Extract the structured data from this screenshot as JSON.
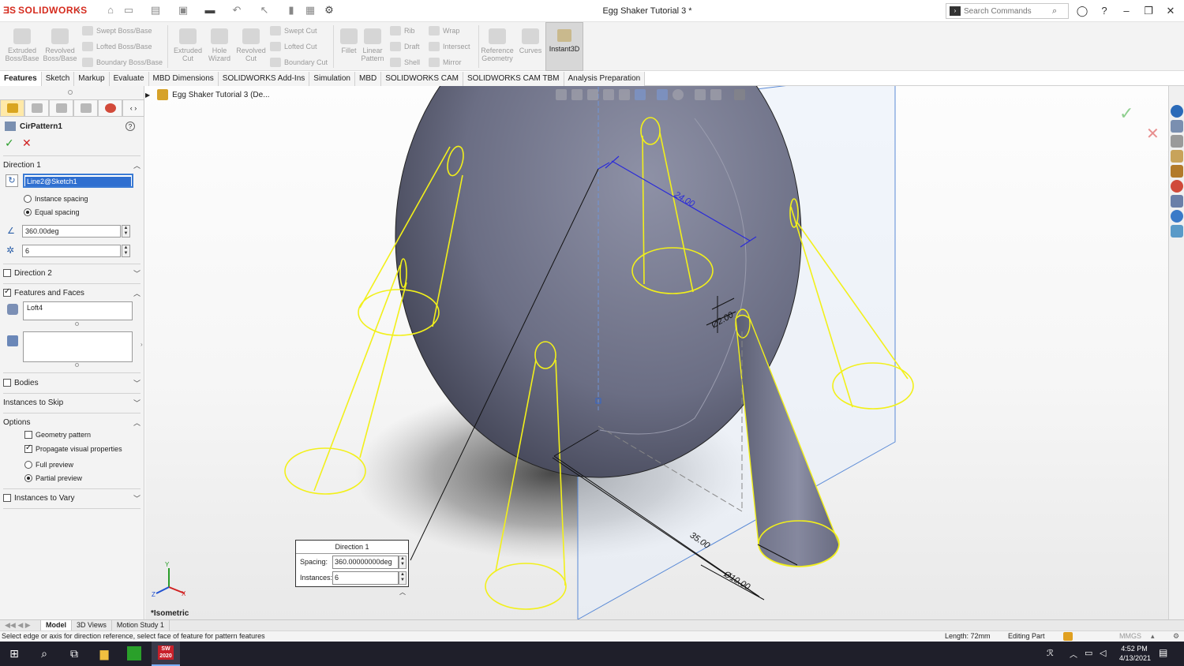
{
  "app": {
    "brand": "SOLIDWORKS",
    "brand_color": "#d52b1e",
    "title": "Egg Shaker Tutorial 3 *",
    "search_placeholder": "Search Commands"
  },
  "ribbon": {
    "extruded_boss": "Extruded Boss/Base",
    "revolved_boss": "Revolved Boss/Base",
    "swept_boss": "Swept Boss/Base",
    "lofted_boss": "Lofted Boss/Base",
    "boundary_boss": "Boundary Boss/Base",
    "extruded_cut": "Extruded Cut",
    "hole_wizard": "Hole Wizard",
    "revolved_cut": "Revolved Cut",
    "swept_cut": "Swept Cut",
    "lofted_cut": "Lofted Cut",
    "boundary_cut": "Boundary Cut",
    "fillet": "Fillet",
    "linear_pattern": "Linear Pattern",
    "rib": "Rib",
    "draft": "Draft",
    "shell": "Shell",
    "wrap": "Wrap",
    "intersect": "Intersect",
    "mirror": "Mirror",
    "reference_geometry": "Reference Geometry",
    "curves": "Curves",
    "instant3d": "Instant3D"
  },
  "tabs": [
    "Features",
    "Sketch",
    "Markup",
    "Evaluate",
    "MBD Dimensions",
    "SOLIDWORKS Add-Ins",
    "Simulation",
    "MBD",
    "SOLIDWORKS CAM",
    "SOLIDWORKS CAM TBM",
    "Analysis Preparation"
  ],
  "property_manager": {
    "title": "CirPattern1",
    "direction1": {
      "label": "Direction 1",
      "axis": "Line2@Sketch1",
      "instance_spacing": "Instance spacing",
      "equal_spacing": "Equal spacing",
      "angle": "360.00deg",
      "count": "6"
    },
    "direction2": "Direction 2",
    "features_faces": {
      "label": "Features and Faces",
      "feature": "Loft4"
    },
    "bodies": "Bodies",
    "instances_to_skip": "Instances to Skip",
    "options": {
      "label": "Options",
      "geometry_pattern": "Geometry pattern",
      "propagate": "Propagate visual properties",
      "full_preview": "Full preview",
      "partial_preview": "Partial preview"
    },
    "instances_to_vary": "Instances to Vary"
  },
  "tree": {
    "root": "Egg Shaker Tutorial 3  (De..."
  },
  "viewport": {
    "view_label": "*Isometric",
    "dims": {
      "d24": "24.00",
      "d2": "Ø2.00",
      "d35": "35.00",
      "d10": "Ø10.00"
    },
    "callout": {
      "title": "Direction 1",
      "spacing_label": "Spacing:",
      "spacing_value": "360.00000000deg",
      "instances_label": "Instances:",
      "instances_value": "6"
    },
    "preview_color": "#f2f01a",
    "dim_color": "#2b2bd8",
    "body_color": "#6b6e82"
  },
  "bottom_tabs": [
    "Model",
    "3D Views",
    "Motion Study 1"
  ],
  "status": {
    "message": "Select edge or axis for direction reference, select face of feature for pattern features",
    "length": "Length: 72mm",
    "mode": "Editing Part",
    "units": "MMGS"
  },
  "taskbar": {
    "time": "4:52 PM",
    "date": "4/13/2021",
    "sw_label": "SW\n2020"
  }
}
